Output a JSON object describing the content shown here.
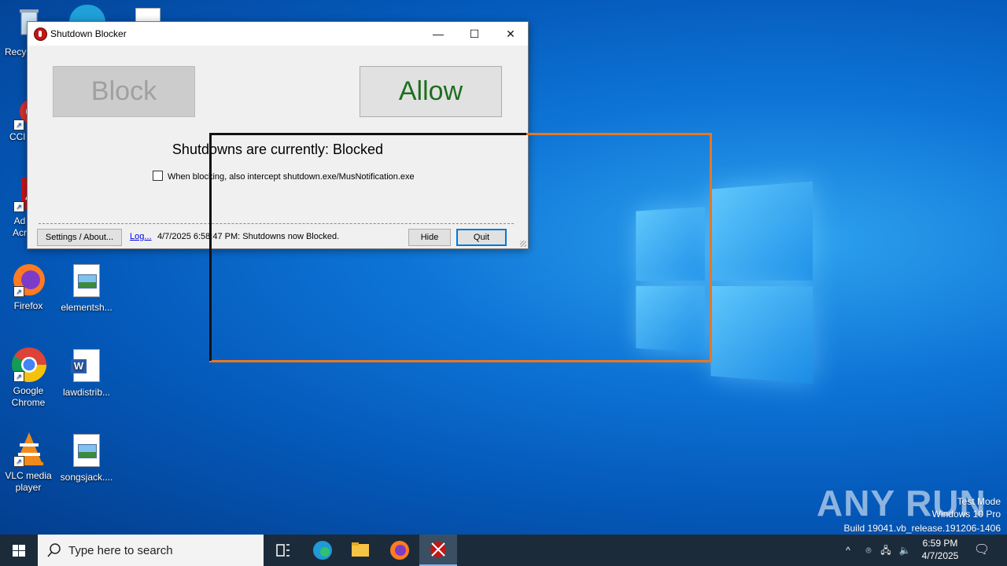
{
  "desktop": {
    "icons": [
      {
        "label": "Recy",
        "name": "recycle-bin"
      },
      {
        "label": "CCl",
        "name": "ccleaner"
      },
      {
        "label": "Ad\nAcr",
        "name": "adobe-acrobat"
      },
      {
        "label": "Firefox",
        "name": "firefox"
      },
      {
        "label": "elementsh...",
        "name": "elementsh-file"
      },
      {
        "label": "Google Chrome",
        "name": "google-chrome"
      },
      {
        "label": "lawdistrib...",
        "name": "lawdistrib-file"
      },
      {
        "label": "VLC media player",
        "name": "vlc"
      },
      {
        "label": "songsjack....",
        "name": "songsjack-file"
      }
    ]
  },
  "window": {
    "title": "Shutdown Blocker",
    "controls": {
      "minimize": "—",
      "maximize": "☐",
      "close": "✕"
    },
    "block_label": "Block",
    "allow_label": "Allow",
    "status_text": "Shutdowns are currently: Blocked",
    "checkbox_label": "When blocking, also intercept shutdown.exe/MusNotification.exe",
    "checkbox_checked": false,
    "settings_label": "Settings / About...",
    "log_link": "Log...",
    "log_text": "4/7/2025 6:58:47 PM: Shutdowns now Blocked.",
    "hide_label": "Hide",
    "quit_label": "Quit"
  },
  "watermark": {
    "line1": "Test Mode",
    "line2": "Windows 10 Pro",
    "line3": "Build 19041.vb_release.191206-1406",
    "brand": "ANY RUN"
  },
  "taskbar": {
    "search_placeholder": "Type here to search",
    "time": "6:59 PM",
    "date": "4/7/2025"
  },
  "colors": {
    "allow_text": "#1e6e1e",
    "block_text_disabled": "#a0a0a0",
    "orange_rect": "#e87722"
  }
}
